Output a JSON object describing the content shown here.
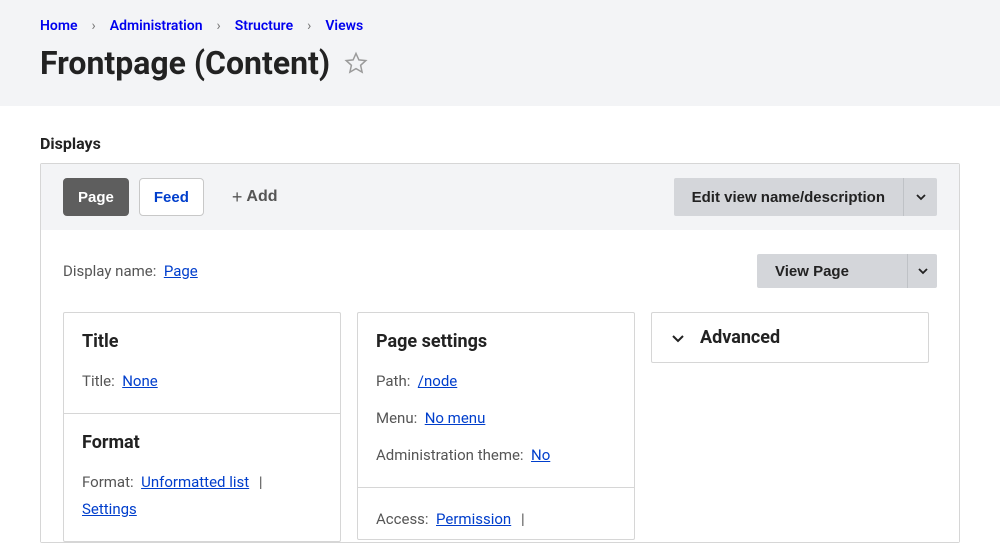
{
  "breadcrumb": {
    "items": [
      "Home",
      "Administration",
      "Structure",
      "Views"
    ]
  },
  "page_title": "Frontpage (Content)",
  "displays": {
    "label": "Displays",
    "tabs": [
      {
        "label": "Page",
        "active": true
      },
      {
        "label": "Feed",
        "active": false
      }
    ],
    "add_label": "Add",
    "edit_button": "Edit view name/description",
    "display_name_label": "Display name:",
    "display_name_value": "Page",
    "view_page_button": "View Page"
  },
  "title_card": {
    "heading": "Title",
    "title_label": "Title:",
    "title_value": "None"
  },
  "format_card": {
    "heading": "Format",
    "format_label": "Format:",
    "format_value": "Unformatted list",
    "settings_label": "Settings"
  },
  "page_settings_card": {
    "heading": "Page settings",
    "path_label": "Path:",
    "path_value": "/node",
    "menu_label": "Menu:",
    "menu_value": "No menu",
    "admin_theme_label": "Administration theme:",
    "admin_theme_value": "No",
    "access_label": "Access:",
    "access_value": "Permission"
  },
  "advanced": {
    "label": "Advanced"
  }
}
